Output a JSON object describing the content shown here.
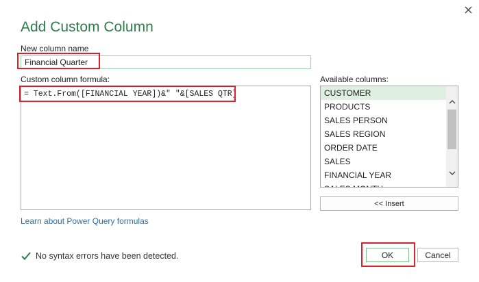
{
  "dialog": {
    "title": "Add Custom Column",
    "close_icon": "close-icon"
  },
  "name_field": {
    "label": "New column name",
    "value": "Financial Quarter"
  },
  "formula": {
    "label": "Custom column formula:",
    "value": "= Text.From([FINANCIAL YEAR])&\" \"&[SALES QTR]"
  },
  "columns": {
    "label": "Available columns:",
    "items": [
      {
        "label": "CUSTOMER",
        "selected": true
      },
      {
        "label": "PRODUCTS"
      },
      {
        "label": "SALES PERSON"
      },
      {
        "label": "SALES REGION"
      },
      {
        "label": "ORDER DATE"
      },
      {
        "label": "SALES"
      },
      {
        "label": "FINANCIAL YEAR"
      },
      {
        "label": "SALES MONTH"
      }
    ],
    "insert_label": "<< Insert"
  },
  "footer": {
    "learn_link": "Learn about Power Query formulas",
    "status_icon": "check-icon",
    "status_text": "No syntax errors have been detected.",
    "ok_label": "OK",
    "cancel_label": "Cancel"
  },
  "colors": {
    "accent": "#2f7d4d",
    "highlight": "#d8232a",
    "selected_row": "#dff0e3",
    "link": "#2e6ea6"
  }
}
